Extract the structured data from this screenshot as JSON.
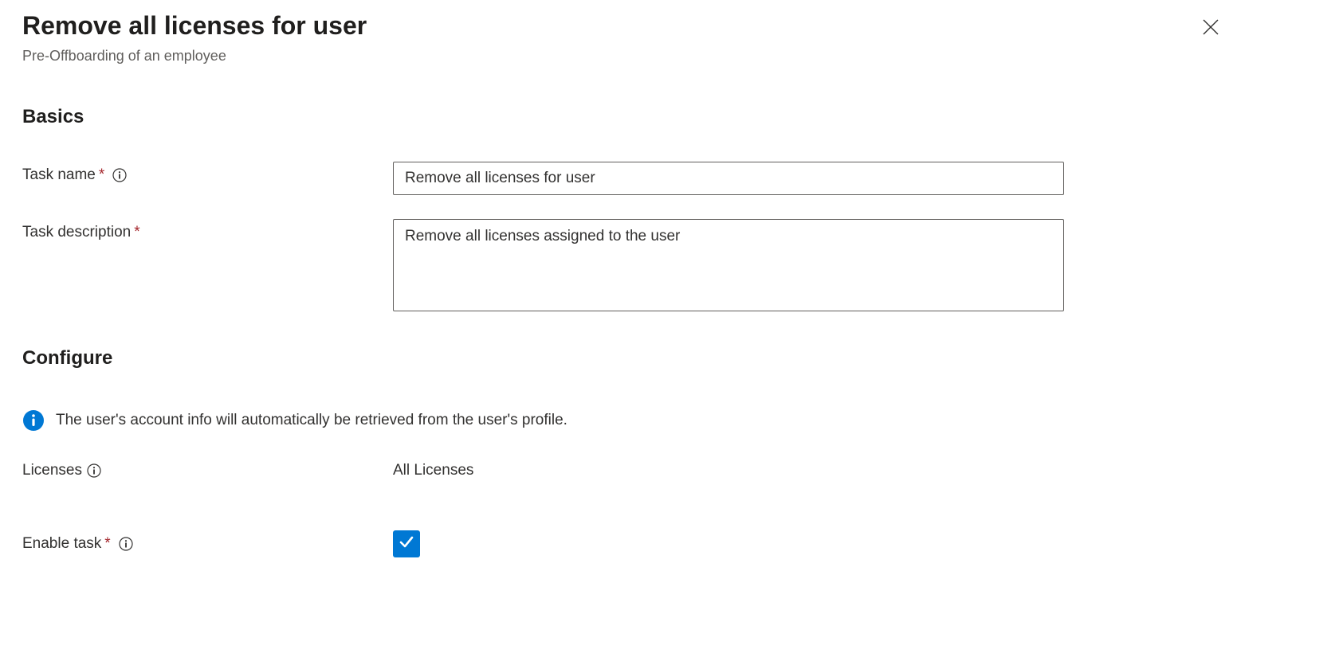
{
  "header": {
    "title": "Remove all licenses for user",
    "subtitle": "Pre-Offboarding of an employee"
  },
  "sections": {
    "basics": "Basics",
    "configure": "Configure"
  },
  "form": {
    "task_name": {
      "label": "Task name",
      "value": "Remove all licenses for user"
    },
    "task_description": {
      "label": "Task description",
      "value": "Remove all licenses assigned to the user"
    },
    "info_message": "The user's account info will automatically be retrieved from the user's profile.",
    "licenses": {
      "label": "Licenses",
      "value": "All Licenses"
    },
    "enable_task": {
      "label": "Enable task",
      "checked": true
    }
  }
}
